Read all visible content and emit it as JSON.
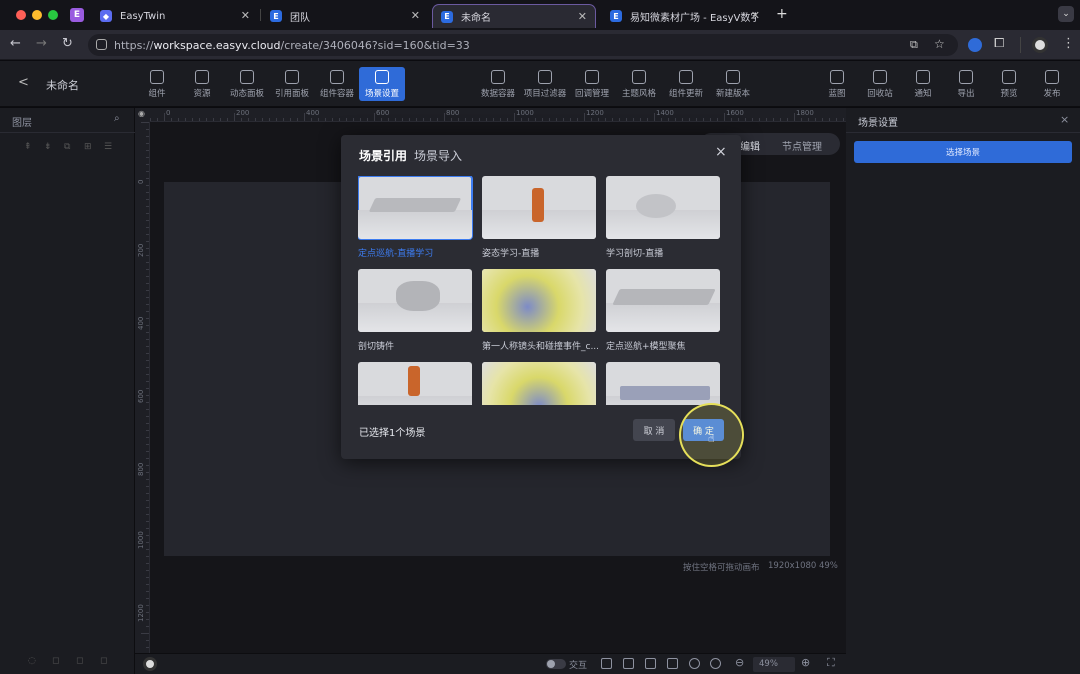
{
  "browser": {
    "tabs": [
      {
        "title": "EasyTwin",
        "active": false
      },
      {
        "title": "团队",
        "active": false
      },
      {
        "title": "未命名",
        "active": true
      },
      {
        "title": "易知微素材广场 - EasyV数字孪",
        "active": false
      }
    ],
    "profile_badge": "E",
    "new_tab": "+",
    "url_scheme": "https://",
    "url_host": "workspace.easyv.cloud",
    "url_path": "/create/3406046?sid=160&tid=33"
  },
  "app": {
    "back_label": "<",
    "title": "未命名",
    "toolbar_left": [
      {
        "label": "组件",
        "icon": "component-icon"
      },
      {
        "label": "资源",
        "icon": "layers-icon"
      },
      {
        "label": "动态面板",
        "icon": "grid-icon"
      },
      {
        "label": "引用面板",
        "icon": "link-icon"
      },
      {
        "label": "组件容器",
        "icon": "container-icon"
      },
      {
        "label": "场景设置",
        "icon": "scene-icon",
        "selected": true
      }
    ],
    "toolbar_mid": [
      {
        "label": "数据容器",
        "icon": "bar-chart-icon"
      },
      {
        "label": "项目过滤器",
        "icon": "filter-icon"
      },
      {
        "label": "回调管理",
        "icon": "sliders-icon"
      },
      {
        "label": "主题风格",
        "icon": "palette-icon"
      },
      {
        "label": "组件更新",
        "icon": "refresh-icon"
      },
      {
        "label": "新建版本",
        "icon": "new-version-icon"
      }
    ],
    "toolbar_right": [
      {
        "label": "蓝图",
        "icon": "blueprint-icon"
      },
      {
        "label": "回收站",
        "icon": "trash-icon"
      },
      {
        "label": "通知",
        "icon": "message-icon"
      },
      {
        "label": "导出",
        "icon": "export-icon"
      },
      {
        "label": "预览",
        "icon": "preview-icon"
      },
      {
        "label": "发布",
        "icon": "send-icon"
      }
    ]
  },
  "left_panel": {
    "title": "图层"
  },
  "right_panel": {
    "title": "场景设置",
    "select_button": "选择场景",
    "close": "×"
  },
  "canvas": {
    "ruler_top": [
      "0",
      "200",
      "400",
      "600",
      "800",
      "1000",
      "1200",
      "1400",
      "1600",
      "1800"
    ],
    "ruler_left": [
      "0",
      "200",
      "400",
      "600",
      "800",
      "1000",
      "1200"
    ],
    "hint": "按住空格可拖动画布",
    "resolution": "1920x1080 49%",
    "behind_tabs": [
      "编辑",
      "节点管理"
    ]
  },
  "bottom_bar": {
    "interact_label": "交互",
    "zoom_value": "49%"
  },
  "modal": {
    "tabs": [
      "场景引用",
      "场景导入"
    ],
    "close": "×",
    "scenes": [
      {
        "name": "定点巡航-直播学习",
        "selected": true
      },
      {
        "name": "姿态学习-直播",
        "selected": false
      },
      {
        "name": "学习剖切-直播",
        "selected": false
      },
      {
        "name": "剖切铸件",
        "selected": false
      },
      {
        "name": "第一人称镜头和碰撞事件_c...",
        "selected": false
      },
      {
        "name": "定点巡航+模型聚焦",
        "selected": false
      },
      {
        "name": "",
        "selected": false
      },
      {
        "name": "",
        "selected": false
      },
      {
        "name": "",
        "selected": false
      }
    ],
    "status": "已选择1个场景",
    "cancel": "取 消",
    "confirm": "确 定"
  }
}
